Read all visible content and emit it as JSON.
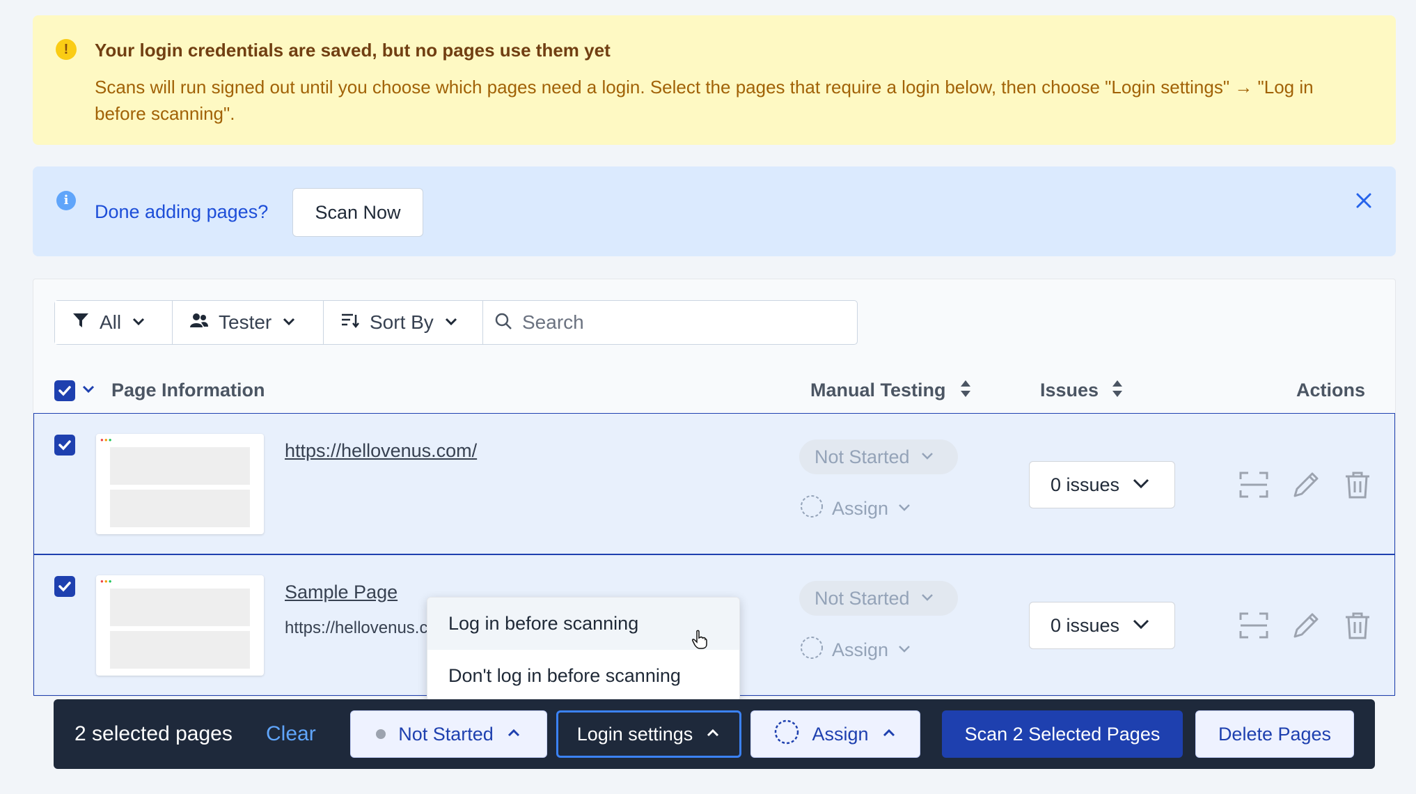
{
  "warning": {
    "title": "Your login credentials are saved, but no pages use them yet",
    "body": "Scans will run signed out until you choose which pages need a login. Select the pages that require a login below, then choose \"Login settings\" → \"Log in before scanning\"."
  },
  "info": {
    "text": "Done adding pages?",
    "scan_now_label": "Scan Now"
  },
  "toolbar": {
    "filter_label": "All",
    "tester_label": "Tester",
    "sort_label": "Sort By",
    "search_placeholder": "Search"
  },
  "table": {
    "headers": {
      "page_info": "Page Information",
      "manual_testing": "Manual Testing",
      "issues": "Issues",
      "actions": "Actions"
    },
    "rows": [
      {
        "title": "https://hellovenus.com/",
        "url": "",
        "status": "Not Started",
        "assign": "Assign",
        "issues": "0 issues",
        "checked": true
      },
      {
        "title": "Sample Page",
        "url": "https://hellovenus.c",
        "status": "Not Started",
        "assign": "Assign",
        "issues": "0 issues",
        "checked": true
      }
    ]
  },
  "login_menu": {
    "items": [
      "Log in before scanning",
      "Don't log in before scanning"
    ]
  },
  "bulk_bar": {
    "count_label": "2 selected pages",
    "clear_label": "Clear",
    "status_label": "Not Started",
    "login_label": "Login settings",
    "assign_label": "Assign",
    "scan_label": "Scan 2 Selected Pages",
    "delete_label": "Delete Pages"
  },
  "colors": {
    "primary": "#1e40af",
    "warning_bg": "#fef9c3",
    "info_bg": "#dbeafe",
    "bar_bg": "#1e293b"
  }
}
